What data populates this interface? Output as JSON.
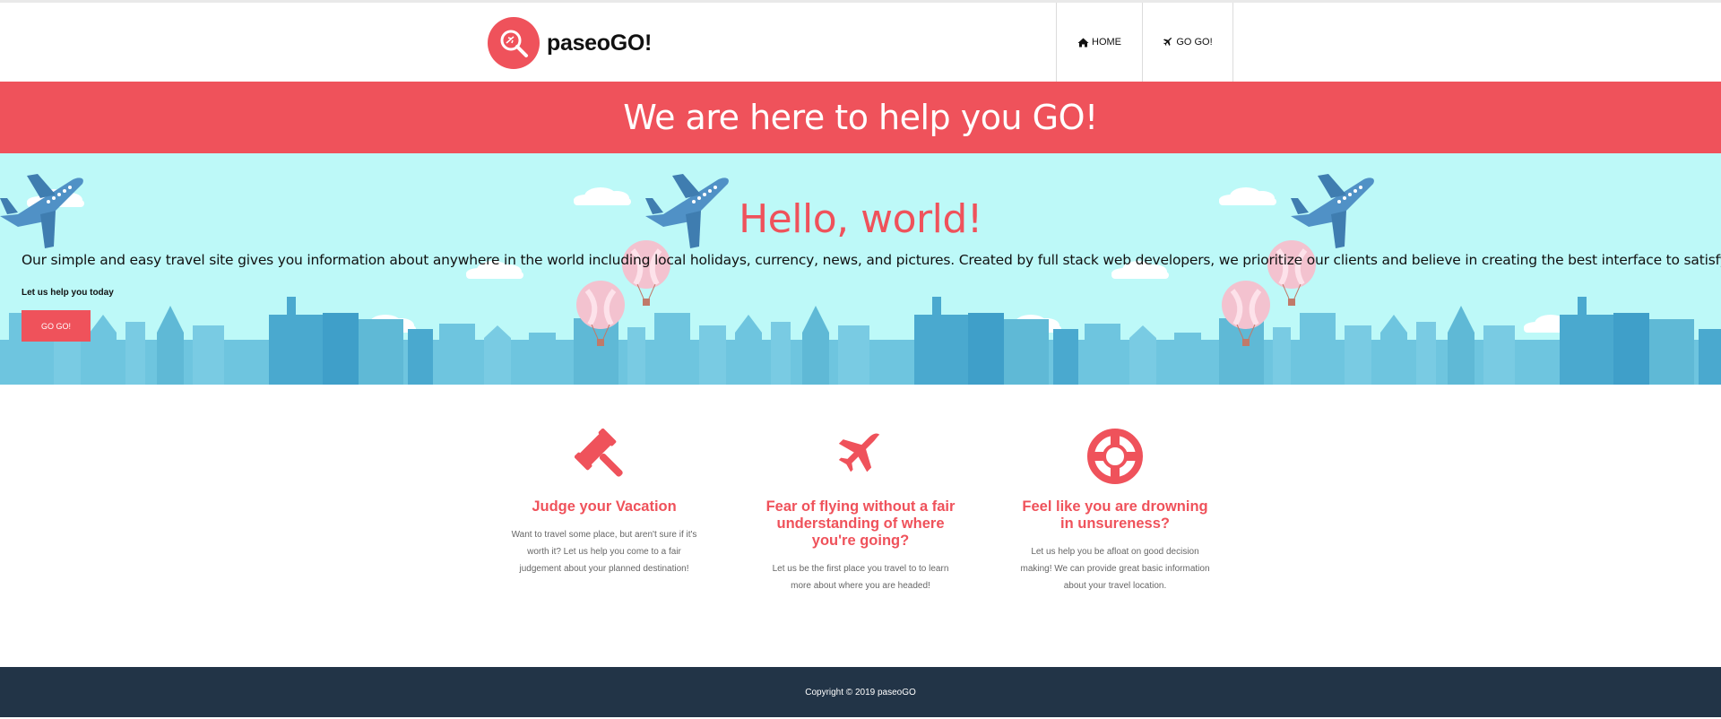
{
  "header": {
    "brand": "paseoGO!",
    "nav": [
      {
        "label": "HOME",
        "icon": "home-icon"
      },
      {
        "label": "GO GO!",
        "icon": "plane-icon"
      }
    ]
  },
  "banner": {
    "title": "We are here to help you GO!"
  },
  "hero": {
    "title": "Hello, world!",
    "text": "Our simple and easy travel site gives you information about anywhere in the world including local holidays, currency, news, and pictures. Created by full stack web developers, we prioritize our clients and believe in creating the best interface to satisfy their travel needs.",
    "subtext": "Let us help you today",
    "button": "GO GO!"
  },
  "features": [
    {
      "icon": "gavel-icon",
      "title": "Judge your Vacation",
      "text": "Want to travel some place, but aren't sure if it's worth it? Let us help you come to a fair judgement about your planned destination!"
    },
    {
      "icon": "plane-icon",
      "title": "Fear of flying without a fair understanding of where you're going?",
      "text": "Let us be the first place you travel to to learn more about where you are headed!"
    },
    {
      "icon": "life-ring-icon",
      "title": "Feel like you are drowning in unsureness?",
      "text": "Let us help you be afloat on good decision making! We can provide great basic information about your travel location."
    }
  ],
  "footer": {
    "copyright": "Copyright © 2019 paseoGO"
  },
  "colors": {
    "accent": "#ef525b",
    "hero_bg": "#bdf9f8",
    "footer_bg": "#223447",
    "skyline": "#5fb9d6"
  }
}
